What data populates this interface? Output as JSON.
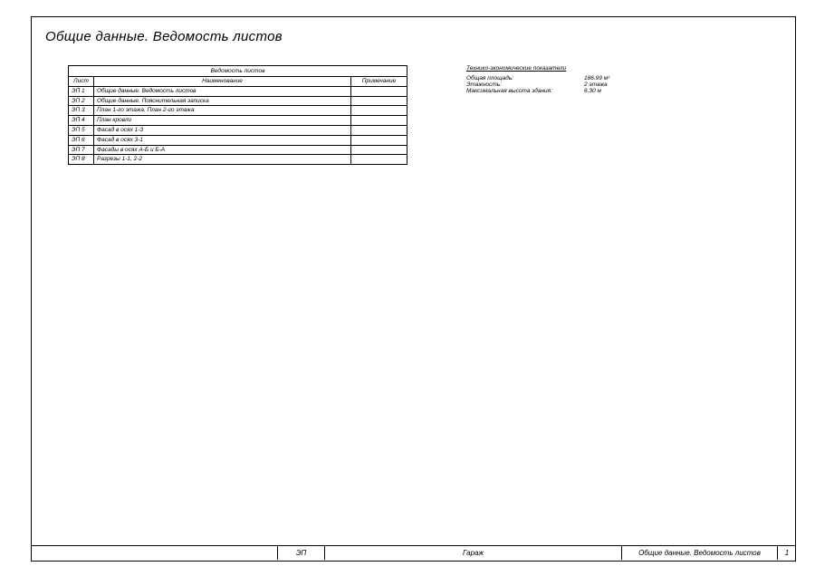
{
  "title": "Общие данные. Ведомость листов",
  "table": {
    "caption": "Ведомость листов",
    "headers": {
      "sheet": "Лист",
      "name": "Наименование",
      "note": "Примечание"
    },
    "rows": [
      {
        "code": "ЭП 1",
        "name": "Общие данные. Ведомость листов",
        "note": ""
      },
      {
        "code": "ЭП 2",
        "name": "Общие данные. Пояснительная записка",
        "note": ""
      },
      {
        "code": "ЭП 3",
        "name": "План 1-го этажа. План 2-го этажа",
        "note": ""
      },
      {
        "code": "ЭП 4",
        "name": "План кровли",
        "note": ""
      },
      {
        "code": "ЭП 5",
        "name": "Фасад в осях 1-3",
        "note": ""
      },
      {
        "code": "ЭП 6",
        "name": "Фасад в осях 3-1",
        "note": ""
      },
      {
        "code": "ЭП 7",
        "name": "Фасады в осях А-Б и Б-А",
        "note": ""
      },
      {
        "code": "ЭП 8",
        "name": "Разрезы 1-1, 2-2",
        "note": ""
      }
    ]
  },
  "tep": {
    "title": "Технико-экономические показатели",
    "items": [
      {
        "k": "Общая площадь:",
        "v": "186.99 м²"
      },
      {
        "k": "Этажность:",
        "v": "2 этажа"
      },
      {
        "k": "Максимальная высота здания:",
        "v": "6.30 м"
      }
    ]
  },
  "stamp": {
    "code": "ЭП",
    "project": "Гараж",
    "sheet_name": "Общие данные. Ведомость листов",
    "page": "1"
  }
}
